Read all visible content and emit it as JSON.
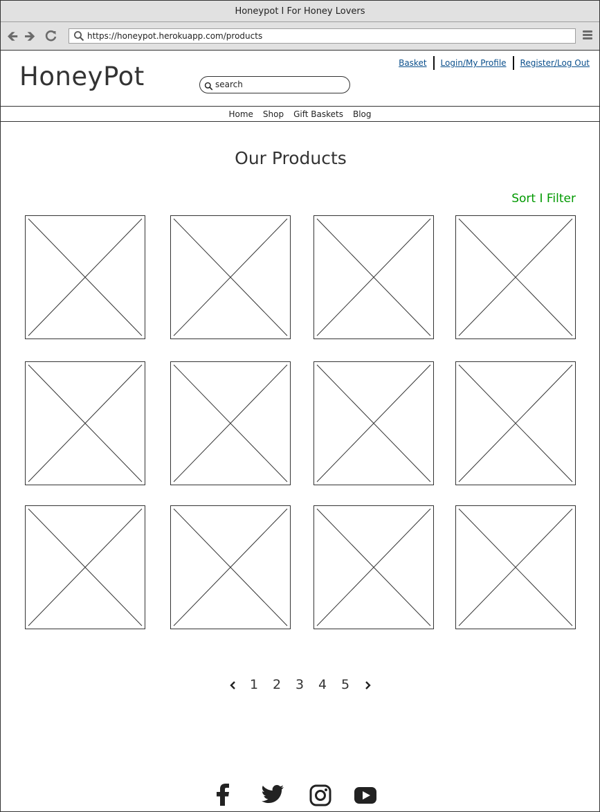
{
  "window": {
    "title": "Honeypot I For Honey Lovers"
  },
  "browser": {
    "url": "https://honeypot.herokuapp.com/products",
    "back_icon": "arrow-left-icon",
    "forward_icon": "arrow-right-icon",
    "reload_icon": "reload-icon",
    "menu_icon": "hamburger-icon"
  },
  "header": {
    "logo": "HoneyPot",
    "search_placeholder": "search",
    "links": {
      "basket": "Basket",
      "login": "Login/My Profile",
      "register": "Register/Log Out"
    }
  },
  "nav": {
    "items": [
      "Home",
      "Shop",
      "Gift Baskets",
      "Blog"
    ]
  },
  "main": {
    "title": "Our Products",
    "sort_filter": "Sort I Filter",
    "product_placeholders": 12
  },
  "pagination": {
    "prev_icon": "chevron-left-icon",
    "pages": [
      "1",
      "2",
      "3",
      "4",
      "5"
    ],
    "next_icon": "chevron-right-icon"
  },
  "footer": {
    "social_icons": [
      "facebook-icon",
      "twitter-icon",
      "instagram-icon",
      "youtube-icon"
    ]
  },
  "colors": {
    "link": "#0a4f8c",
    "accent_green": "#009900",
    "chrome_bg": "#e1e1e1"
  }
}
